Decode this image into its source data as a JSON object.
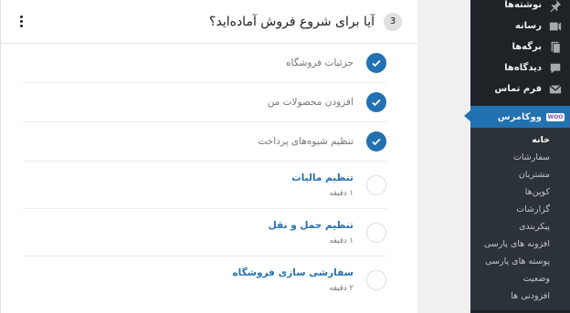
{
  "sidebar": {
    "items": [
      {
        "label": "نوشته‌ها",
        "icon": "pin-icon"
      },
      {
        "label": "رسانه",
        "icon": "media-icon"
      },
      {
        "label": "برگه‌ها",
        "icon": "pages-icon"
      },
      {
        "label": "دیدگاه‌ها",
        "icon": "comments-icon"
      },
      {
        "label": "فرم تماس",
        "icon": "mail-icon"
      }
    ],
    "woocommerce": {
      "label": "ووکامرس",
      "badge": "WOO"
    },
    "submenu": [
      "خانه",
      "سفارشات",
      "مشتریان",
      "کوپن‌ها",
      "گزارشات",
      "پیکربندی",
      "افزونه های پارسی",
      "پوسته های پارسی",
      "وضعیت",
      "افزودنی ها"
    ]
  },
  "card": {
    "title": "آیا برای شروع فروش آماده‌اید؟",
    "count": "3",
    "tasks_done": [
      "جزئیات فروشگاه",
      "افزودن محصولات من",
      "تنظیم شیوه‌های پرداخت"
    ],
    "tasks_todo": [
      {
        "title": "تنظیم مالیات",
        "time": "۱ دقیقه"
      },
      {
        "title": "تنظیم حمل و نقل",
        "time": "۱ دقیقه"
      },
      {
        "title": "سفارشی سازی فروشگاه",
        "time": "۲ دقیقه"
      }
    ]
  },
  "colors": {
    "accent": "#2271b1",
    "sidebar": "#1d2327",
    "submenu": "#2c3338"
  }
}
